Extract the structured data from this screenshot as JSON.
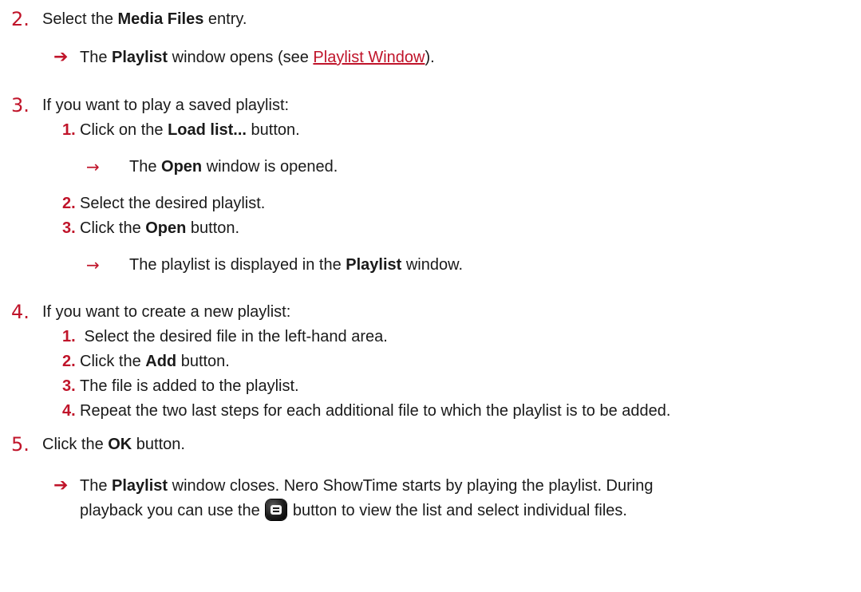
{
  "step2": {
    "num": "2.",
    "pre": "Select the ",
    "bold": "Media Files",
    "post": " entry.",
    "result": {
      "arrow": "➔",
      "pre": "The ",
      "bold": "Playlist",
      "mid": " window opens (see ",
      "link": "Playlist Window",
      "post": ")."
    }
  },
  "step3": {
    "num": "3.",
    "text": "If you want to play a saved playlist:",
    "sub1": {
      "num": "1.",
      "pre": "Click on the ",
      "bold": "Load list...",
      "post": " button.",
      "result": {
        "arrow": "→",
        "pre": "The ",
        "bold": "Open",
        "post": " window is opened."
      }
    },
    "sub2": {
      "num": "2.",
      "text": "Select the desired playlist."
    },
    "sub3": {
      "num": "3.",
      "pre": "Click the ",
      "bold": "Open",
      "post": " button.",
      "result": {
        "arrow": "→",
        "pre": "The playlist is displayed in the ",
        "bold": "Playlist",
        "post": " window."
      }
    }
  },
  "step4": {
    "num": "4.",
    "text": "If you want to create a new playlist:",
    "sub1": {
      "num": "1.",
      "text": " Select the desired file in the left-hand area."
    },
    "sub2": {
      "num": "2.",
      "pre": "Click the ",
      "bold": "Add",
      "post": " button."
    },
    "sub3": {
      "num": "3.",
      "text": "The file is added to the playlist."
    },
    "sub4": {
      "num": "4.",
      "text": "Repeat the two last steps for each additional file to which the playlist is to be added."
    }
  },
  "step5": {
    "num": "5.",
    "pre": "Click the ",
    "bold": "OK",
    "post": " button.",
    "result": {
      "arrow": "➔",
      "pre": "The ",
      "bold": "Playlist",
      "line1_post": " window closes. Nero ShowTime starts by playing the playlist. During",
      "line2_pre": "playback you can use the ",
      "icon": "playlist-button-icon",
      "line2_post": " button to view the list and select individual files."
    }
  },
  "colors": {
    "accent": "#c0142a",
    "text": "#1a1a1a"
  }
}
